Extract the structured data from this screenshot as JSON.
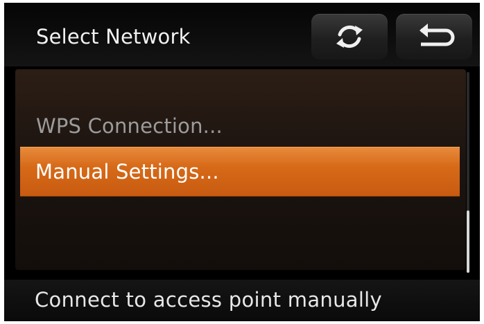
{
  "header": {
    "title": "Select Network",
    "refresh_icon": "refresh-icon",
    "back_icon": "back-arrow-icon"
  },
  "menu": {
    "items": [
      {
        "label": "WPS Connection...",
        "state": "normal"
      },
      {
        "label": "Manual Settings...",
        "state": "selected"
      }
    ]
  },
  "footer": {
    "hint": "Connect to access point manually"
  },
  "colors": {
    "selection": "#d66a18",
    "background": "#000000",
    "text": "#f2f2f2",
    "dimmed_text": "#9c9c9c"
  }
}
